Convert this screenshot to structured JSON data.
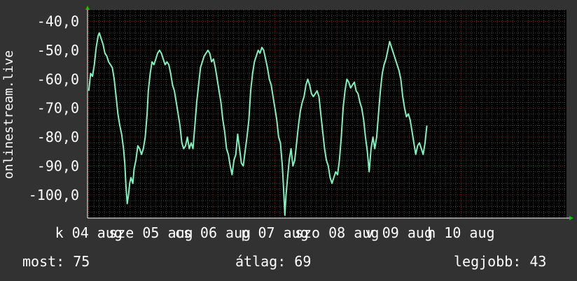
{
  "chart_data": {
    "type": "line",
    "ylabel": "onlinestream.live",
    "ylim": [
      -108,
      -36
    ],
    "y_ticks": [
      -40,
      -50,
      -60,
      -70,
      -80,
      -90,
      -100
    ],
    "y_tick_labels": [
      "-40,0",
      "-50,0",
      "-60,0",
      "-70,0",
      "-80,0",
      "-90,0",
      "-100,0"
    ],
    "x_ticks": [
      {
        "label": "k 04 aug",
        "t": 0.0
      },
      {
        "label": "sze 05 aug",
        "t": 1.0
      },
      {
        "label": "cs 06 aug",
        "t": 2.0
      },
      {
        "label": "p 07 aug",
        "t": 3.0
      },
      {
        "label": "szo 08 aug",
        "t": 4.0
      },
      {
        "label": "v 09 aug",
        "t": 5.0
      },
      {
        "label": "h 10 aug",
        "t": 6.0
      }
    ],
    "x_range": [
      -0.02,
      7.7
    ],
    "grid": true,
    "colors": {
      "background": "#323232",
      "plot": "#000000",
      "line": "#7ff2c0",
      "grid_major": "#7a2424",
      "grid_minor": "#4a4a4a",
      "arrow": "#00cc00"
    },
    "series": [
      {
        "points": [
          [
            0.0,
            -64
          ],
          [
            0.03,
            -58
          ],
          [
            0.06,
            -59
          ],
          [
            0.09,
            -55
          ],
          [
            0.12,
            -49
          ],
          [
            0.15,
            -45
          ],
          [
            0.17,
            -44
          ],
          [
            0.2,
            -46
          ],
          [
            0.23,
            -48
          ],
          [
            0.26,
            -51
          ],
          [
            0.29,
            -52
          ],
          [
            0.32,
            -54
          ],
          [
            0.35,
            -55
          ],
          [
            0.38,
            -56
          ],
          [
            0.41,
            -60
          ],
          [
            0.44,
            -66
          ],
          [
            0.47,
            -72
          ],
          [
            0.5,
            -76
          ],
          [
            0.53,
            -79
          ],
          [
            0.56,
            -84
          ],
          [
            0.58,
            -89
          ],
          [
            0.6,
            -97
          ],
          [
            0.62,
            -103
          ],
          [
            0.64,
            -100
          ],
          [
            0.66,
            -96
          ],
          [
            0.68,
            -94
          ],
          [
            0.71,
            -96
          ],
          [
            0.73,
            -91
          ],
          [
            0.76,
            -88
          ],
          [
            0.79,
            -83
          ],
          [
            0.82,
            -84
          ],
          [
            0.85,
            -86
          ],
          [
            0.88,
            -84
          ],
          [
            0.91,
            -80
          ],
          [
            0.94,
            -72
          ],
          [
            0.96,
            -64
          ],
          [
            0.99,
            -58
          ],
          [
            1.02,
            -54
          ],
          [
            1.05,
            -55
          ],
          [
            1.08,
            -53
          ],
          [
            1.11,
            -51
          ],
          [
            1.14,
            -50
          ],
          [
            1.17,
            -51
          ],
          [
            1.2,
            -53
          ],
          [
            1.23,
            -55
          ],
          [
            1.26,
            -54
          ],
          [
            1.29,
            -55
          ],
          [
            1.32,
            -58
          ],
          [
            1.35,
            -62
          ],
          [
            1.38,
            -64
          ],
          [
            1.41,
            -68
          ],
          [
            1.44,
            -72
          ],
          [
            1.47,
            -76
          ],
          [
            1.5,
            -82
          ],
          [
            1.53,
            -84
          ],
          [
            1.56,
            -83
          ],
          [
            1.59,
            -80
          ],
          [
            1.62,
            -84
          ],
          [
            1.65,
            -82
          ],
          [
            1.68,
            -84
          ],
          [
            1.71,
            -76
          ],
          [
            1.74,
            -68
          ],
          [
            1.77,
            -62
          ],
          [
            1.8,
            -56
          ],
          [
            1.83,
            -54
          ],
          [
            1.86,
            -52
          ],
          [
            1.89,
            -51
          ],
          [
            1.92,
            -50
          ],
          [
            1.95,
            -51
          ],
          [
            1.98,
            -54
          ],
          [
            2.01,
            -53
          ],
          [
            2.04,
            -56
          ],
          [
            2.07,
            -60
          ],
          [
            2.1,
            -64
          ],
          [
            2.13,
            -68
          ],
          [
            2.16,
            -74
          ],
          [
            2.19,
            -78
          ],
          [
            2.22,
            -84
          ],
          [
            2.25,
            -86
          ],
          [
            2.28,
            -90
          ],
          [
            2.31,
            -93
          ],
          [
            2.34,
            -88
          ],
          [
            2.37,
            -86
          ],
          [
            2.4,
            -79
          ],
          [
            2.43,
            -84
          ],
          [
            2.46,
            -89
          ],
          [
            2.49,
            -90
          ],
          [
            2.52,
            -85
          ],
          [
            2.55,
            -80
          ],
          [
            2.58,
            -74
          ],
          [
            2.61,
            -64
          ],
          [
            2.64,
            -58
          ],
          [
            2.67,
            -54
          ],
          [
            2.7,
            -52
          ],
          [
            2.73,
            -50
          ],
          [
            2.76,
            -51
          ],
          [
            2.79,
            -49
          ],
          [
            2.82,
            -50
          ],
          [
            2.85,
            -53
          ],
          [
            2.88,
            -56
          ],
          [
            2.91,
            -60
          ],
          [
            2.94,
            -62
          ],
          [
            2.97,
            -66
          ],
          [
            3.0,
            -70
          ],
          [
            3.03,
            -74
          ],
          [
            3.06,
            -80
          ],
          [
            3.09,
            -82
          ],
          [
            3.12,
            -90
          ],
          [
            3.14,
            -98
          ],
          [
            3.16,
            -107
          ],
          [
            3.18,
            -100
          ],
          [
            3.2,
            -95
          ],
          [
            3.23,
            -88
          ],
          [
            3.26,
            -84
          ],
          [
            3.29,
            -90
          ],
          [
            3.32,
            -88
          ],
          [
            3.35,
            -82
          ],
          [
            3.38,
            -76
          ],
          [
            3.41,
            -71
          ],
          [
            3.44,
            -68
          ],
          [
            3.47,
            -66
          ],
          [
            3.5,
            -62
          ],
          [
            3.53,
            -60
          ],
          [
            3.56,
            -62
          ],
          [
            3.59,
            -65
          ],
          [
            3.62,
            -66
          ],
          [
            3.65,
            -65
          ],
          [
            3.68,
            -64
          ],
          [
            3.71,
            -66
          ],
          [
            3.74,
            -72
          ],
          [
            3.77,
            -78
          ],
          [
            3.8,
            -84
          ],
          [
            3.83,
            -88
          ],
          [
            3.86,
            -90
          ],
          [
            3.89,
            -94
          ],
          [
            3.92,
            -96
          ],
          [
            3.95,
            -94
          ],
          [
            3.98,
            -92
          ],
          [
            4.01,
            -93
          ],
          [
            4.04,
            -88
          ],
          [
            4.07,
            -80
          ],
          [
            4.1,
            -70
          ],
          [
            4.13,
            -64
          ],
          [
            4.16,
            -60
          ],
          [
            4.19,
            -61
          ],
          [
            4.22,
            -63
          ],
          [
            4.25,
            -62
          ],
          [
            4.28,
            -61
          ],
          [
            4.31,
            -64
          ],
          [
            4.34,
            -65
          ],
          [
            4.37,
            -68
          ],
          [
            4.4,
            -70
          ],
          [
            4.43,
            -74
          ],
          [
            4.46,
            -80
          ],
          [
            4.49,
            -85
          ],
          [
            4.52,
            -92
          ],
          [
            4.55,
            -84
          ],
          [
            4.58,
            -80
          ],
          [
            4.61,
            -84
          ],
          [
            4.64,
            -80
          ],
          [
            4.67,
            -72
          ],
          [
            4.7,
            -64
          ],
          [
            4.73,
            -58
          ],
          [
            4.76,
            -55
          ],
          [
            4.79,
            -53
          ],
          [
            4.82,
            -50
          ],
          [
            4.85,
            -47
          ],
          [
            4.88,
            -49
          ],
          [
            4.91,
            -51
          ],
          [
            4.94,
            -53
          ],
          [
            4.97,
            -55
          ],
          [
            5.0,
            -57
          ],
          [
            5.03,
            -60
          ],
          [
            5.06,
            -66
          ],
          [
            5.09,
            -70
          ],
          [
            5.12,
            -73
          ],
          [
            5.15,
            -72
          ],
          [
            5.18,
            -74
          ],
          [
            5.21,
            -78
          ],
          [
            5.24,
            -82
          ],
          [
            5.27,
            -86
          ],
          [
            5.3,
            -83
          ],
          [
            5.33,
            -82
          ],
          [
            5.36,
            -84
          ],
          [
            5.39,
            -86
          ],
          [
            5.42,
            -82
          ],
          [
            5.45,
            -76
          ]
        ]
      }
    ]
  },
  "stats": {
    "current": "most: 75",
    "average": "átlag: 69",
    "best": "legjobb: 43"
  }
}
